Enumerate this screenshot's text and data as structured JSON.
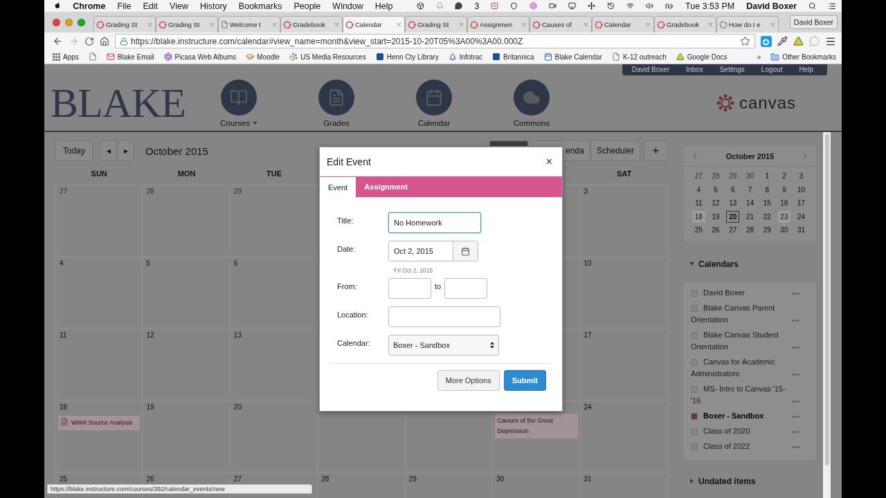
{
  "menubar": {
    "app": "Chrome",
    "menus": [
      "File",
      "Edit",
      "View",
      "History",
      "Bookmarks",
      "People",
      "Window",
      "Help"
    ],
    "badge": "3",
    "clock": "Tue 3:53 PM",
    "user": "David Boxer"
  },
  "tabs": [
    {
      "label": "Grading St",
      "kind": "canvas",
      "selected": false
    },
    {
      "label": "Grading St",
      "kind": "canvas",
      "selected": false
    },
    {
      "label": "Welcome t",
      "kind": "page",
      "selected": false
    },
    {
      "label": "Gradebook",
      "kind": "canvas",
      "selected": false
    },
    {
      "label": "Calendar",
      "kind": "canvas",
      "selected": true
    },
    {
      "label": "Grading St",
      "kind": "canvas",
      "selected": false
    },
    {
      "label": "Assignmen",
      "kind": "canvas",
      "selected": false
    },
    {
      "label": "Causes of",
      "kind": "canvas",
      "selected": false
    },
    {
      "label": "Calendar",
      "kind": "canvas",
      "selected": false
    },
    {
      "label": "Gradebook",
      "kind": "canvas",
      "selected": false
    },
    {
      "label": "How do I e",
      "kind": "loading",
      "selected": false
    }
  ],
  "profile_button": "David Boxer",
  "address": "https://blake.instructure.com/calendar#view_name=month&view_start=2015-10-20T05%3A00%3A00.000Z",
  "bookmarks": [
    {
      "label": "Apps",
      "kind": "apps"
    },
    {
      "kind": "page"
    },
    {
      "label": "Blake Email",
      "kind": "mail"
    },
    {
      "label": "Picasa Web Albums",
      "kind": "pinwheel"
    },
    {
      "label": "Moodle",
      "kind": "hat"
    },
    {
      "label": "US Media Resources",
      "kind": "paw"
    },
    {
      "label": "Henn Cty Library",
      "kind": "square"
    },
    {
      "label": "Infotrac",
      "kind": "tree"
    },
    {
      "label": "Britannica",
      "kind": "square"
    },
    {
      "label": "Blake Calendar",
      "kind": "calendar"
    },
    {
      "label": "K-12 outreach",
      "kind": "page"
    },
    {
      "label": "Google Docs",
      "kind": "drive"
    }
  ],
  "bookmarks_overflow": "»",
  "other_bookmarks": "Other Bookmarks",
  "account_links": [
    "David Boxer",
    "Inbox",
    "Settings",
    "Logout",
    "Help"
  ],
  "logo": "BLAKE",
  "nav": [
    {
      "label": "Courses",
      "kind": "courses",
      "dropdown": true
    },
    {
      "label": "Grades",
      "kind": "grades",
      "dropdown": false
    },
    {
      "label": "Calendar",
      "kind": "calendar",
      "dropdown": false
    },
    {
      "label": "Commons",
      "kind": "commons",
      "dropdown": false
    }
  ],
  "brand": "canvas",
  "toolbar": {
    "today": "Today",
    "prev": "◂",
    "next": "▸",
    "title": "October 2015",
    "views": [
      {
        "selected": true
      },
      {
        "label": "enda",
        "selected": false
      },
      {
        "label": "Scheduler",
        "selected": false
      }
    ],
    "add": "+"
  },
  "weekdays": {
    "sun": "SUN",
    "mon": "MON",
    "tue": "TUE",
    "sat": "SAT"
  },
  "weeks": [
    {
      "sun": {
        "day": "27",
        "faded": true
      },
      "mon": {
        "day": "28",
        "faded": true
      },
      "tue": {
        "day": "29",
        "faded": true
      },
      "sat": {
        "day": "3",
        "faded": false
      }
    },
    {
      "sun": {
        "day": "4",
        "faded": false
      },
      "mon": {
        "day": "5",
        "faded": false
      },
      "tue": {
        "day": "6",
        "faded": false
      },
      "sat": {
        "day": "10",
        "faded": false
      }
    },
    {
      "sun": {
        "day": "11",
        "faded": false
      },
      "mon": {
        "day": "12",
        "faded": false
      },
      "tue": {
        "day": "13",
        "faded": false
      },
      "sat": {
        "day": "17",
        "faded": false
      }
    },
    {
      "sun": {
        "day": "18",
        "faded": false,
        "events": [
          {
            "title": "WWII Source Analysis",
            "kind": "assignment"
          }
        ]
      },
      "mon": {
        "day": "19",
        "faded": false
      },
      "tue": {
        "day": "20",
        "faded": false
      },
      "fri": {
        "events": [
          {
            "title": "Causes of the Great Depression",
            "kind": "event"
          }
        ]
      },
      "sat": {
        "day": "24",
        "faded": false
      }
    },
    {
      "sun": {
        "day": "25",
        "faded": false
      },
      "mon": {
        "day": "26",
        "faded": false
      },
      "tue": {
        "day": "27",
        "faded": false
      },
      "wed": {
        "day": "28",
        "faded": false
      },
      "thu": {
        "day": "29",
        "faded": false
      },
      "fri": {
        "day": "30",
        "faded": false
      },
      "sat": {
        "day": "31",
        "faded": false
      }
    }
  ],
  "mini_calendar": {
    "title": "October 2015",
    "days": [
      {
        "day": "27",
        "kind": "other"
      },
      {
        "day": "28",
        "kind": "other"
      },
      {
        "day": "29",
        "kind": "other"
      },
      {
        "day": "30",
        "kind": "other"
      },
      {
        "day": "1",
        "kind": "day"
      },
      {
        "day": "2",
        "kind": "day"
      },
      {
        "day": "3",
        "kind": "day"
      },
      {
        "day": "4",
        "kind": "day"
      },
      {
        "day": "5",
        "kind": "day"
      },
      {
        "day": "6",
        "kind": "day"
      },
      {
        "day": "7",
        "kind": "day"
      },
      {
        "day": "8",
        "kind": "day"
      },
      {
        "day": "9",
        "kind": "day"
      },
      {
        "day": "10",
        "kind": "day"
      },
      {
        "day": "11",
        "kind": "day"
      },
      {
        "day": "12",
        "kind": "day"
      },
      {
        "day": "13",
        "kind": "day"
      },
      {
        "day": "14",
        "kind": "day"
      },
      {
        "day": "15",
        "kind": "day"
      },
      {
        "day": "16",
        "kind": "day"
      },
      {
        "day": "17",
        "kind": "day"
      },
      {
        "day": "18",
        "kind": "marked"
      },
      {
        "day": "19",
        "kind": "day"
      },
      {
        "day": "20",
        "kind": "today"
      },
      {
        "day": "21",
        "kind": "day"
      },
      {
        "day": "22",
        "kind": "day"
      },
      {
        "day": "23",
        "kind": "marked"
      },
      {
        "day": "24",
        "kind": "day"
      },
      {
        "day": "25",
        "kind": "day"
      },
      {
        "day": "26",
        "kind": "day"
      },
      {
        "day": "27",
        "kind": "day"
      },
      {
        "day": "28",
        "kind": "day"
      },
      {
        "day": "29",
        "kind": "day"
      },
      {
        "day": "30",
        "kind": "day"
      },
      {
        "day": "31",
        "kind": "day"
      }
    ]
  },
  "calendars": {
    "title": "Calendars",
    "expanded": true,
    "items": [
      {
        "name": "David Boxer",
        "checked": false
      },
      {
        "name": "Blake Canvas Parent Orientation",
        "checked": false
      },
      {
        "name": "Blake Canvas Student Orientation",
        "checked": false
      },
      {
        "name": "Canvas for Academic Administrators",
        "checked": false
      },
      {
        "name": "MS- Intro to Canvas '15-'16",
        "checked": false
      },
      {
        "name": "Boxer - Sandbox",
        "checked": true
      },
      {
        "name": "Class of 2020",
        "checked": false
      },
      {
        "name": "Class of 2022",
        "checked": false
      }
    ]
  },
  "undated": {
    "title": "Undated items",
    "expanded": false
  },
  "modal": {
    "title": "Edit Event",
    "close": "×",
    "tabs": [
      {
        "label": "Event",
        "selected": true
      },
      {
        "label": "Assignment",
        "selected": false
      }
    ],
    "fields": [
      {
        "kind": "text",
        "label": "Title:",
        "value": "No Homework",
        "focused": true
      },
      {
        "kind": "date",
        "label": "Date:",
        "value": "Oct 2, 2015",
        "hint": "Fri Oct 2, 2015"
      },
      {
        "kind": "range",
        "label": "From:",
        "joiner": "to"
      },
      {
        "kind": "text",
        "label": "Location:",
        "focused": false
      },
      {
        "kind": "select",
        "label": "Calendar:",
        "value": "Boxer - Sandbox"
      }
    ],
    "buttons": [
      {
        "label": "More Options",
        "kind": "secondary"
      },
      {
        "label": "Submit",
        "kind": "primary"
      }
    ]
  },
  "status_url": "https://blake.instructure.com/courses/392/calendar_events/new"
}
